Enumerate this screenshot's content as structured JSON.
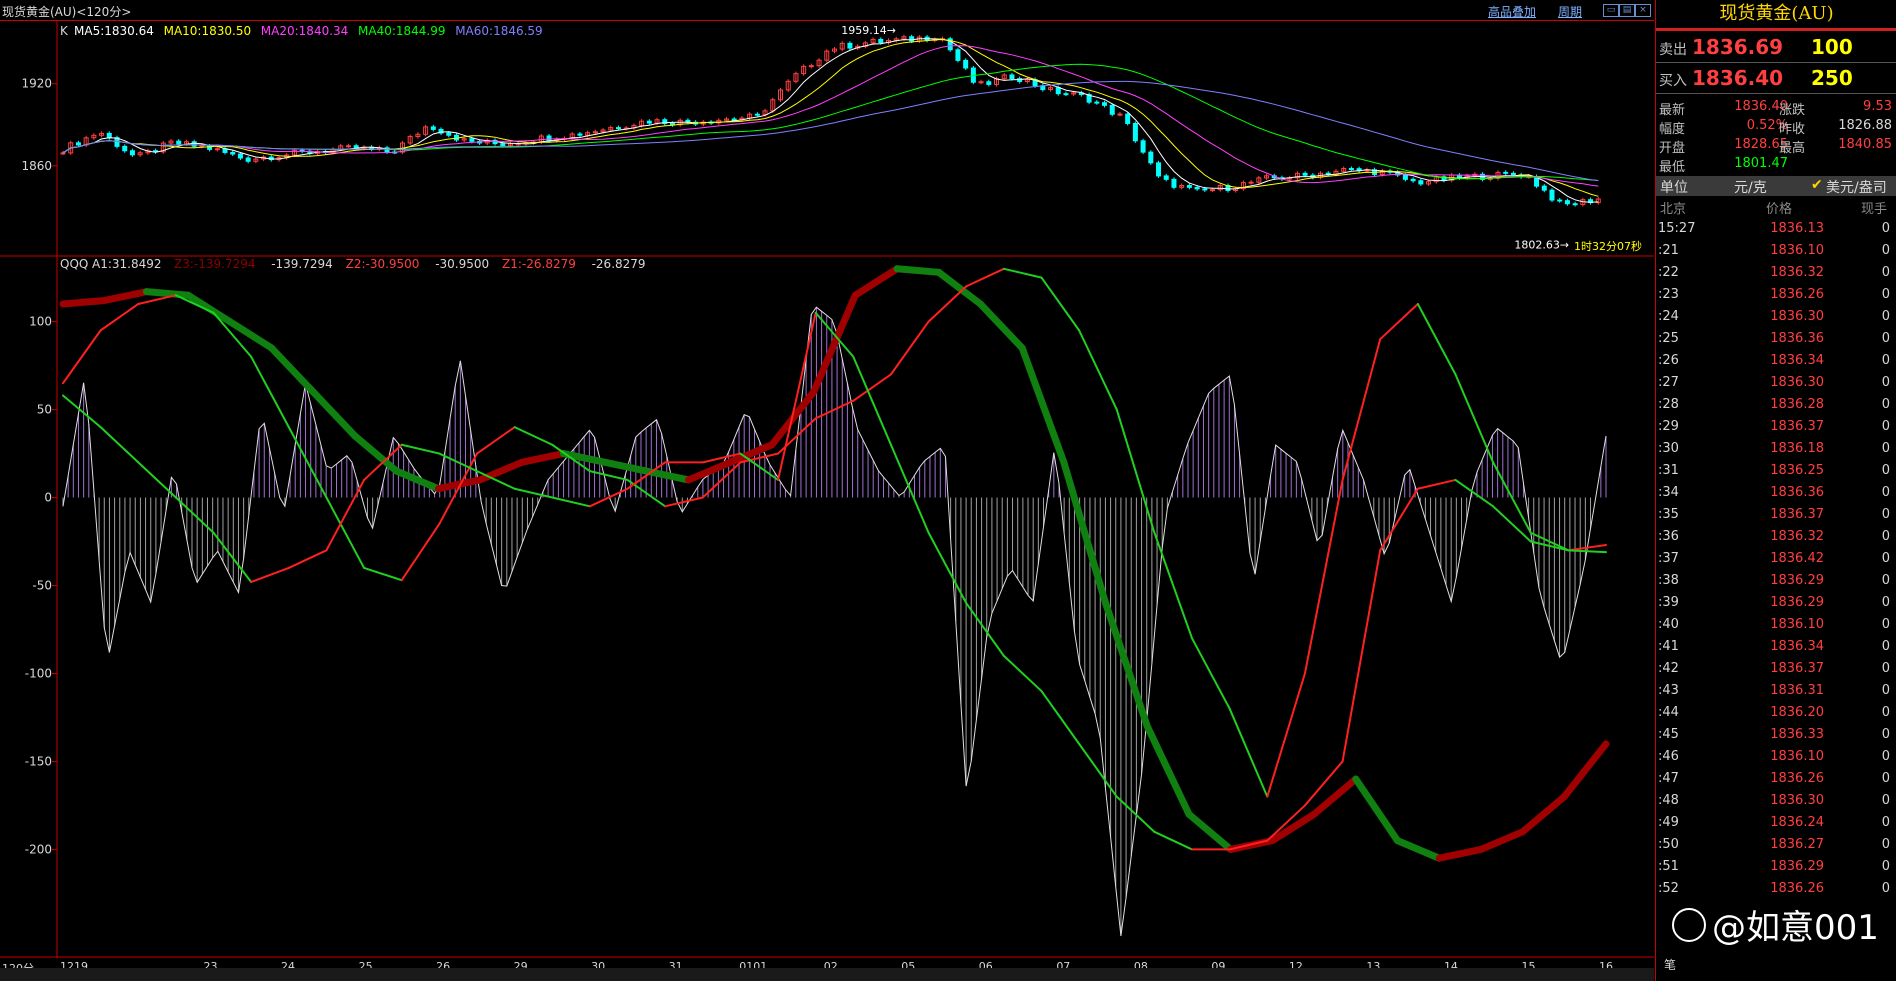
{
  "window": {
    "title": "现货黄金(AU)<120分>",
    "link_overlay": "高品叠加",
    "link_period": "周期"
  },
  "price_panel": {
    "legend_k": "K",
    "ma": [
      {
        "label": "MA5:1830.64",
        "color": "#ffffff"
      },
      {
        "label": "MA10:1830.50",
        "color": "#ffff00"
      },
      {
        "label": "MA20:1840.34",
        "color": "#ff40ff"
      },
      {
        "label": "MA40:1844.99",
        "color": "#00ff00"
      },
      {
        "label": "MA60:1846.59",
        "color": "#8080ff"
      }
    ],
    "y_ticks": [
      "1920",
      "1860"
    ],
    "high_label": "1959.14",
    "low_label": "1802.63",
    "countdown": "1时32分07秒"
  },
  "indicator_panel": {
    "legend_name": "QQQ",
    "legend": [
      {
        "label": "A1:31.8492",
        "color": "#d8d8d8"
      },
      {
        "label": "Z3:-139.7294",
        "color": "#8b0000"
      },
      {
        "label": "-139.7294",
        "color": "#d8d8d8"
      },
      {
        "label": "Z2:-30.9500",
        "color": "#ff4040"
      },
      {
        "label": "-30.9500",
        "color": "#d8d8d8"
      },
      {
        "label": "Z1:-26.8279",
        "color": "#ff4040"
      },
      {
        "label": "-26.8279",
        "color": "#d8d8d8"
      }
    ],
    "y_ticks": [
      "100",
      "50",
      "0",
      "-50",
      "-100",
      "-150",
      "-200"
    ]
  },
  "x_axis": {
    "period_label": "120分",
    "labels": [
      "1219",
      "23",
      "24",
      "25",
      "26",
      "29",
      "30",
      "31",
      "0101",
      "02",
      "05",
      "06",
      "07",
      "08",
      "09",
      "12",
      "13",
      "14",
      "15",
      "16"
    ]
  },
  "chart_data": [
    {
      "type": "candlestick",
      "title": "现货黄金(AU)<120分>",
      "y_ticks": [
        1920,
        1860
      ],
      "ylim": [
        1795,
        1965
      ],
      "high": 1959.14,
      "low": 1802.63,
      "x_labels": [
        "1219",
        "23",
        "24",
        "25",
        "26",
        "29",
        "30",
        "31",
        "0101",
        "02",
        "05",
        "06",
        "07",
        "08",
        "09",
        "12",
        "13",
        "14",
        "15",
        "16"
      ],
      "close_path": [
        1872,
        1885,
        1866,
        1877,
        1873,
        1865,
        1868,
        1871,
        1873,
        1870,
        1890,
        1878,
        1876,
        1880,
        1883,
        1888,
        1893,
        1892,
        1894,
        1896,
        1925,
        1946,
        1950,
        1952,
        1955,
        1918,
        1926,
        1915,
        1910,
        1895,
        1850,
        1841,
        1845,
        1851,
        1853,
        1857,
        1856,
        1848,
        1851,
        1853,
        1854,
        1831,
        1836
      ],
      "ma_series": [
        {
          "name": "MA5",
          "last": 1830.64
        },
        {
          "name": "MA10",
          "last": 1830.5
        },
        {
          "name": "MA20",
          "last": 1840.34
        },
        {
          "name": "MA40",
          "last": 1844.99
        },
        {
          "name": "MA60",
          "last": 1846.59
        }
      ]
    },
    {
      "type": "line",
      "title": "QQQ",
      "y_ticks": [
        100,
        50,
        0,
        -50,
        -100,
        -150,
        -200
      ],
      "ylim": [
        -260,
        135
      ],
      "series": [
        {
          "name": "A1",
          "last": 31.8492,
          "style": "histogram",
          "values": [
            -5,
            70,
            -95,
            -30,
            -60,
            18,
            -50,
            -30,
            -55,
            50,
            -10,
            65,
            15,
            25,
            -20,
            35,
            15,
            0,
            80,
            -5,
            -55,
            -20,
            10,
            25,
            40,
            -10,
            35,
            45,
            -10,
            10,
            20,
            50,
            20,
            0,
            110,
            100,
            40,
            15,
            0,
            20,
            30,
            -170,
            -70,
            -40,
            -60,
            30,
            -90,
            -130,
            -250,
            -150,
            -10,
            30,
            60,
            70,
            -50,
            30,
            20,
            -30,
            40,
            10,
            -35,
            20,
            -20,
            -60,
            10,
            40,
            30,
            -55,
            -95,
            -40,
            35
          ]
        },
        {
          "name": "Z1",
          "last": -26.8279,
          "values": [
            65,
            95,
            110,
            115,
            105,
            80,
            40,
            0,
            -40,
            -47,
            -15,
            25,
            40,
            30,
            15,
            10,
            -5,
            0,
            20,
            25,
            45,
            55,
            70,
            100,
            120,
            130,
            125,
            95,
            50,
            -20,
            -80,
            -120,
            -170,
            -100,
            10,
            90,
            110,
            70,
            20,
            -20,
            -30,
            -27
          ]
        },
        {
          "name": "Z2",
          "last": -30.95,
          "values": [
            58,
            40,
            20,
            0,
            -20,
            -48,
            -40,
            -30,
            10,
            30,
            25,
            15,
            5,
            0,
            -5,
            5,
            20,
            20,
            25,
            10,
            105,
            80,
            30,
            -20,
            -60,
            -90,
            -110,
            -140,
            -170,
            -190,
            -200,
            -200,
            -195,
            -175,
            -150,
            -30,
            5,
            10,
            -5,
            -25,
            -30,
            -31
          ]
        },
        {
          "name": "Z3",
          "last": -139.7294,
          "values": [
            110,
            112,
            117,
            115,
            100,
            85,
            60,
            35,
            15,
            5,
            10,
            20,
            25,
            20,
            15,
            10,
            20,
            30,
            60,
            115,
            130,
            128,
            110,
            85,
            20,
            -60,
            -130,
            -180,
            -200,
            -195,
            -180,
            -160,
            -195,
            -205,
            -200,
            -190,
            -170,
            -140
          ]
        }
      ]
    }
  ],
  "right_panel": {
    "title": "现货黄金(AU)",
    "sell_label": "卖出",
    "sell_price": "1836.69",
    "sell_vol": "100",
    "buy_label": "买入",
    "buy_price": "1836.40",
    "buy_vol": "250",
    "stats": [
      {
        "l1": "最新",
        "v1": "1836.40",
        "c1": "#ff4040",
        "l2": "涨跌",
        "v2": "9.53",
        "c2": "#ff4040"
      },
      {
        "l1": "幅度",
        "v1": "0.52%",
        "c1": "#ff4040",
        "l2": "昨收",
        "v2": "1826.88",
        "c2": "#d8d8d8"
      },
      {
        "l1": "开盘",
        "v1": "1828.65",
        "c1": "#ff4040",
        "l2": "最高",
        "v2": "1840.85",
        "c2": "#ff4040"
      },
      {
        "l1": "最低",
        "v1": "1801.47",
        "c1": "#00ff00",
        "l2": "",
        "v2": "",
        "c2": "#d8d8d8"
      }
    ],
    "unit_label": "单位",
    "unit_cny": "元/克",
    "unit_usd": "美元/盎司",
    "col_time": "北京",
    "col_price": "价格",
    "col_vol": "现手",
    "ticks": [
      {
        "t": "15:27",
        "p": "1836.13",
        "v": "0"
      },
      {
        "t": ":21",
        "p": "1836.10",
        "v": "0"
      },
      {
        "t": ":22",
        "p": "1836.32",
        "v": "0"
      },
      {
        "t": ":23",
        "p": "1836.26",
        "v": "0"
      },
      {
        "t": ":24",
        "p": "1836.30",
        "v": "0"
      },
      {
        "t": ":25",
        "p": "1836.36",
        "v": "0"
      },
      {
        "t": ":26",
        "p": "1836.34",
        "v": "0"
      },
      {
        "t": ":27",
        "p": "1836.30",
        "v": "0"
      },
      {
        "t": ":28",
        "p": "1836.28",
        "v": "0"
      },
      {
        "t": ":29",
        "p": "1836.37",
        "v": "0"
      },
      {
        "t": ":30",
        "p": "1836.18",
        "v": "0"
      },
      {
        "t": ":31",
        "p": "1836.25",
        "v": "0"
      },
      {
        "t": ":34",
        "p": "1836.36",
        "v": "0"
      },
      {
        "t": ":35",
        "p": "1836.37",
        "v": "0"
      },
      {
        "t": ":36",
        "p": "1836.32",
        "v": "0"
      },
      {
        "t": ":37",
        "p": "1836.42",
        "v": "0"
      },
      {
        "t": ":38",
        "p": "1836.29",
        "v": "0"
      },
      {
        "t": ":39",
        "p": "1836.29",
        "v": "0"
      },
      {
        "t": ":40",
        "p": "1836.10",
        "v": "0"
      },
      {
        "t": ":41",
        "p": "1836.34",
        "v": "0"
      },
      {
        "t": ":42",
        "p": "1836.37",
        "v": "0"
      },
      {
        "t": ":43",
        "p": "1836.31",
        "v": "0"
      },
      {
        "t": ":44",
        "p": "1836.20",
        "v": "0"
      },
      {
        "t": ":45",
        "p": "1836.33",
        "v": "0"
      },
      {
        "t": ":46",
        "p": "1836.10",
        "v": "0"
      },
      {
        "t": ":47",
        "p": "1836.26",
        "v": "0"
      },
      {
        "t": ":48",
        "p": "1836.30",
        "v": "0"
      },
      {
        "t": ":49",
        "p": "1836.24",
        "v": "0"
      },
      {
        "t": ":50",
        "p": "1836.27",
        "v": "0"
      },
      {
        "t": ":51",
        "p": "1836.29",
        "v": "0"
      },
      {
        "t": ":52",
        "p": "1836.26",
        "v": "0"
      }
    ],
    "footer_tab": "笔"
  },
  "watermark": "@如意001"
}
